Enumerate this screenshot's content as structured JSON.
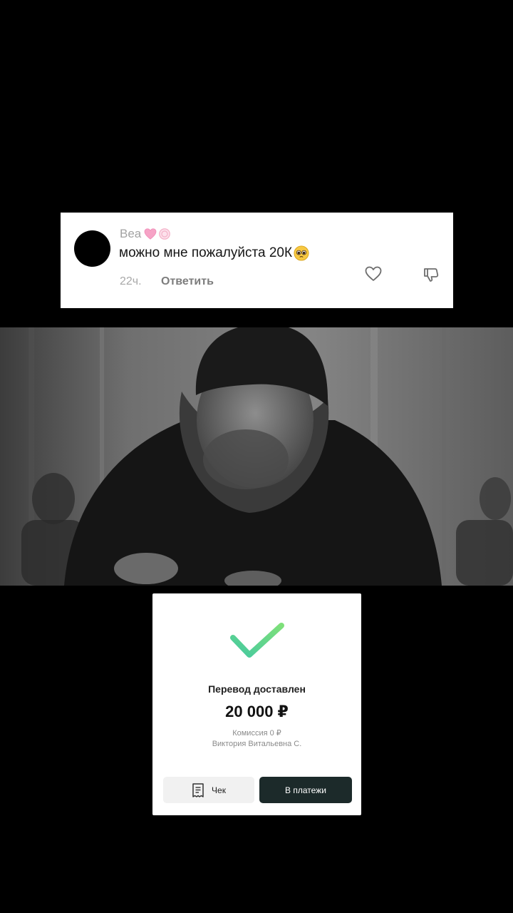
{
  "comment": {
    "username": "Bea",
    "text": "можно мне пожалуйста 20К",
    "time": "22ч.",
    "reply_label": "Ответить"
  },
  "payment": {
    "title": "Перевод доставлен",
    "amount": "20 000 ₽",
    "fee": "Комиссия 0 ₽",
    "recipient": "Виктория Витальевна С.",
    "receipt_label": "Чек",
    "payments_label": "В платежи",
    "accent_green": "#3ed598"
  }
}
